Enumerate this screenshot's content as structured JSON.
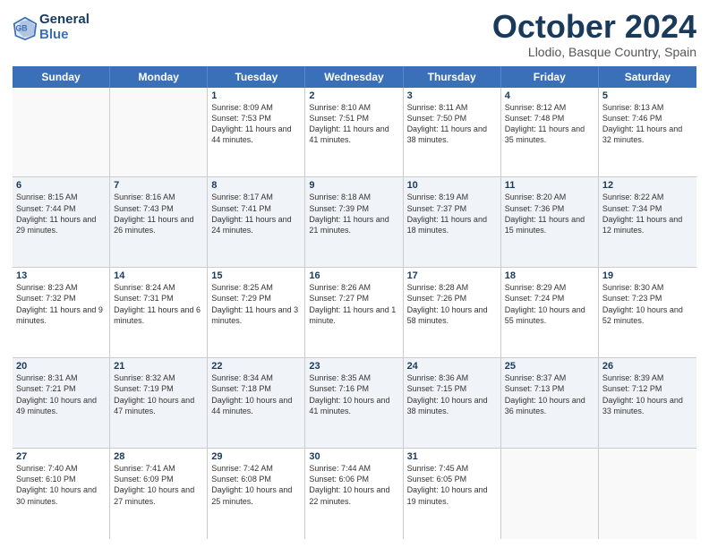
{
  "header": {
    "logo_line1": "General",
    "logo_line2": "Blue",
    "title": "October 2024",
    "location": "Llodio, Basque Country, Spain"
  },
  "days_of_week": [
    "Sunday",
    "Monday",
    "Tuesday",
    "Wednesday",
    "Thursday",
    "Friday",
    "Saturday"
  ],
  "weeks": [
    [
      {
        "day": "",
        "sunrise": "",
        "sunset": "",
        "daylight": ""
      },
      {
        "day": "",
        "sunrise": "",
        "sunset": "",
        "daylight": ""
      },
      {
        "day": "1",
        "sunrise": "Sunrise: 8:09 AM",
        "sunset": "Sunset: 7:53 PM",
        "daylight": "Daylight: 11 hours and 44 minutes."
      },
      {
        "day": "2",
        "sunrise": "Sunrise: 8:10 AM",
        "sunset": "Sunset: 7:51 PM",
        "daylight": "Daylight: 11 hours and 41 minutes."
      },
      {
        "day": "3",
        "sunrise": "Sunrise: 8:11 AM",
        "sunset": "Sunset: 7:50 PM",
        "daylight": "Daylight: 11 hours and 38 minutes."
      },
      {
        "day": "4",
        "sunrise": "Sunrise: 8:12 AM",
        "sunset": "Sunset: 7:48 PM",
        "daylight": "Daylight: 11 hours and 35 minutes."
      },
      {
        "day": "5",
        "sunrise": "Sunrise: 8:13 AM",
        "sunset": "Sunset: 7:46 PM",
        "daylight": "Daylight: 11 hours and 32 minutes."
      }
    ],
    [
      {
        "day": "6",
        "sunrise": "Sunrise: 8:15 AM",
        "sunset": "Sunset: 7:44 PM",
        "daylight": "Daylight: 11 hours and 29 minutes."
      },
      {
        "day": "7",
        "sunrise": "Sunrise: 8:16 AM",
        "sunset": "Sunset: 7:43 PM",
        "daylight": "Daylight: 11 hours and 26 minutes."
      },
      {
        "day": "8",
        "sunrise": "Sunrise: 8:17 AM",
        "sunset": "Sunset: 7:41 PM",
        "daylight": "Daylight: 11 hours and 24 minutes."
      },
      {
        "day": "9",
        "sunrise": "Sunrise: 8:18 AM",
        "sunset": "Sunset: 7:39 PM",
        "daylight": "Daylight: 11 hours and 21 minutes."
      },
      {
        "day": "10",
        "sunrise": "Sunrise: 8:19 AM",
        "sunset": "Sunset: 7:37 PM",
        "daylight": "Daylight: 11 hours and 18 minutes."
      },
      {
        "day": "11",
        "sunrise": "Sunrise: 8:20 AM",
        "sunset": "Sunset: 7:36 PM",
        "daylight": "Daylight: 11 hours and 15 minutes."
      },
      {
        "day": "12",
        "sunrise": "Sunrise: 8:22 AM",
        "sunset": "Sunset: 7:34 PM",
        "daylight": "Daylight: 11 hours and 12 minutes."
      }
    ],
    [
      {
        "day": "13",
        "sunrise": "Sunrise: 8:23 AM",
        "sunset": "Sunset: 7:32 PM",
        "daylight": "Daylight: 11 hours and 9 minutes."
      },
      {
        "day": "14",
        "sunrise": "Sunrise: 8:24 AM",
        "sunset": "Sunset: 7:31 PM",
        "daylight": "Daylight: 11 hours and 6 minutes."
      },
      {
        "day": "15",
        "sunrise": "Sunrise: 8:25 AM",
        "sunset": "Sunset: 7:29 PM",
        "daylight": "Daylight: 11 hours and 3 minutes."
      },
      {
        "day": "16",
        "sunrise": "Sunrise: 8:26 AM",
        "sunset": "Sunset: 7:27 PM",
        "daylight": "Daylight: 11 hours and 1 minute."
      },
      {
        "day": "17",
        "sunrise": "Sunrise: 8:28 AM",
        "sunset": "Sunset: 7:26 PM",
        "daylight": "Daylight: 10 hours and 58 minutes."
      },
      {
        "day": "18",
        "sunrise": "Sunrise: 8:29 AM",
        "sunset": "Sunset: 7:24 PM",
        "daylight": "Daylight: 10 hours and 55 minutes."
      },
      {
        "day": "19",
        "sunrise": "Sunrise: 8:30 AM",
        "sunset": "Sunset: 7:23 PM",
        "daylight": "Daylight: 10 hours and 52 minutes."
      }
    ],
    [
      {
        "day": "20",
        "sunrise": "Sunrise: 8:31 AM",
        "sunset": "Sunset: 7:21 PM",
        "daylight": "Daylight: 10 hours and 49 minutes."
      },
      {
        "day": "21",
        "sunrise": "Sunrise: 8:32 AM",
        "sunset": "Sunset: 7:19 PM",
        "daylight": "Daylight: 10 hours and 47 minutes."
      },
      {
        "day": "22",
        "sunrise": "Sunrise: 8:34 AM",
        "sunset": "Sunset: 7:18 PM",
        "daylight": "Daylight: 10 hours and 44 minutes."
      },
      {
        "day": "23",
        "sunrise": "Sunrise: 8:35 AM",
        "sunset": "Sunset: 7:16 PM",
        "daylight": "Daylight: 10 hours and 41 minutes."
      },
      {
        "day": "24",
        "sunrise": "Sunrise: 8:36 AM",
        "sunset": "Sunset: 7:15 PM",
        "daylight": "Daylight: 10 hours and 38 minutes."
      },
      {
        "day": "25",
        "sunrise": "Sunrise: 8:37 AM",
        "sunset": "Sunset: 7:13 PM",
        "daylight": "Daylight: 10 hours and 36 minutes."
      },
      {
        "day": "26",
        "sunrise": "Sunrise: 8:39 AM",
        "sunset": "Sunset: 7:12 PM",
        "daylight": "Daylight: 10 hours and 33 minutes."
      }
    ],
    [
      {
        "day": "27",
        "sunrise": "Sunrise: 7:40 AM",
        "sunset": "Sunset: 6:10 PM",
        "daylight": "Daylight: 10 hours and 30 minutes."
      },
      {
        "day": "28",
        "sunrise": "Sunrise: 7:41 AM",
        "sunset": "Sunset: 6:09 PM",
        "daylight": "Daylight: 10 hours and 27 minutes."
      },
      {
        "day": "29",
        "sunrise": "Sunrise: 7:42 AM",
        "sunset": "Sunset: 6:08 PM",
        "daylight": "Daylight: 10 hours and 25 minutes."
      },
      {
        "day": "30",
        "sunrise": "Sunrise: 7:44 AM",
        "sunset": "Sunset: 6:06 PM",
        "daylight": "Daylight: 10 hours and 22 minutes."
      },
      {
        "day": "31",
        "sunrise": "Sunrise: 7:45 AM",
        "sunset": "Sunset: 6:05 PM",
        "daylight": "Daylight: 10 hours and 19 minutes."
      },
      {
        "day": "",
        "sunrise": "",
        "sunset": "",
        "daylight": ""
      },
      {
        "day": "",
        "sunrise": "",
        "sunset": "",
        "daylight": ""
      }
    ]
  ]
}
